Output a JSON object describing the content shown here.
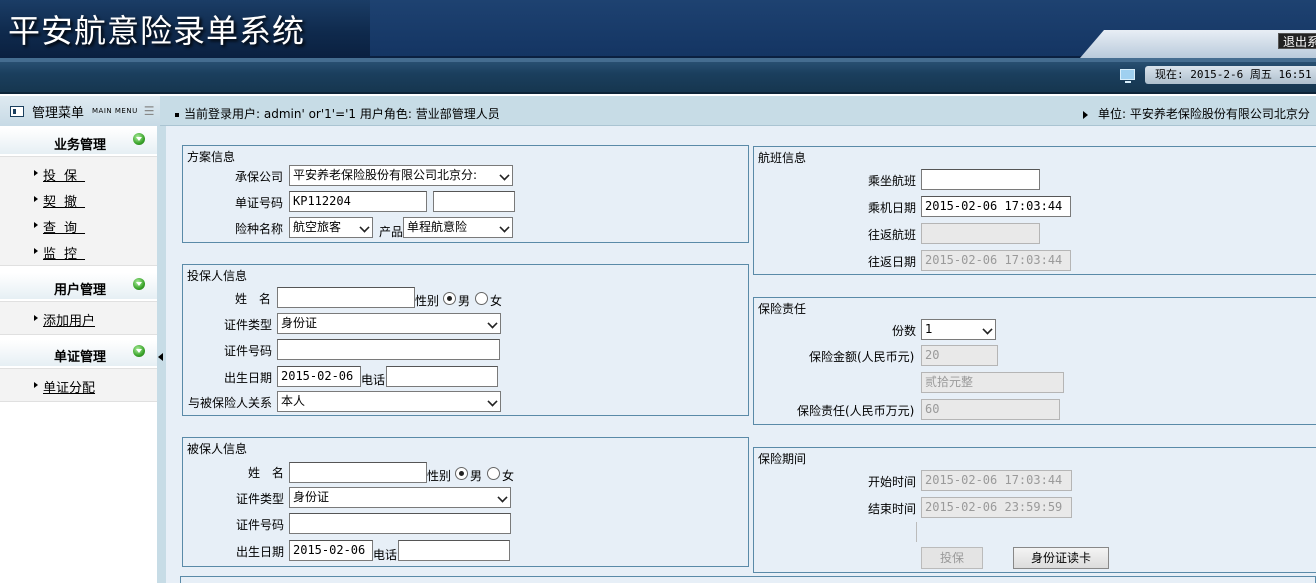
{
  "header": {
    "title": "平安航意险录单系统",
    "logout_label": "退出系",
    "time_text": "现在: 2015-2-6 周五 16:51"
  },
  "subheader": {
    "menu_label": "管理菜单",
    "menu_label_en": "MAIN MENU",
    "user_info": "当前登录用户: admin' or'1'='1   用户角色: 营业部管理人员",
    "unit_info": "单位: 平安养老保险股份有限公司北京分"
  },
  "sidebar": {
    "groups": [
      {
        "title": "业务管理",
        "items": [
          {
            "label": "投保"
          },
          {
            "label": "契撤"
          },
          {
            "label": "查询"
          },
          {
            "label": "监控"
          }
        ]
      },
      {
        "title": "用户管理",
        "items": [
          {
            "label": "添加用户"
          }
        ]
      },
      {
        "title": "单证管理",
        "items": [
          {
            "label": "单证分配"
          }
        ]
      }
    ]
  },
  "plan": {
    "legend": "方案信息",
    "company_label": "承保公司",
    "company_value": "平安养老保险股份有限公司北京分:",
    "cert_label": "单证号码",
    "cert_value": "KP112204",
    "cert_value2": "",
    "type_label": "险种名称",
    "type_value": "航空旅客",
    "product_label": "产品",
    "product_value": "单程航意险"
  },
  "applicant": {
    "legend": "投保人信息",
    "name_label": "姓  名",
    "name_value": "",
    "gender_label": "性别",
    "male": "男",
    "female": "女",
    "idtype_label": "证件类型",
    "idtype_value": "身份证",
    "idno_label": "证件号码",
    "idno_value": "",
    "birth_label": "出生日期",
    "birth_value": "2015-02-06",
    "phone_label": "电话",
    "phone_value": "",
    "relation_label": "与被保险人关系",
    "relation_value": "本人"
  },
  "insured": {
    "legend": "被保人信息",
    "name_label": "姓  名",
    "name_value": "",
    "gender_label": "性别",
    "male": "男",
    "female": "女",
    "idtype_label": "证件类型",
    "idtype_value": "身份证",
    "idno_label": "证件号码",
    "idno_value": "",
    "birth_label": "出生日期",
    "birth_value": "2015-02-06",
    "phone_label": "电话",
    "phone_value": ""
  },
  "flight": {
    "legend": "航班信息",
    "flight_label": "乘坐航班",
    "flight_value": "",
    "date_label": "乘机日期",
    "date_value": "2015-02-06 17:03:44",
    "return_flight_label": "往返航班",
    "return_flight_value": "",
    "return_date_label": "往返日期",
    "return_date_value": "2015-02-06 17:03:44"
  },
  "liability": {
    "legend": "保险责任",
    "copies_label": "份数",
    "copies_value": "1",
    "amount_label": "保险金额(人民币元)",
    "amount_value": "20",
    "amount_words": "贰拾元整",
    "liab_label": "保险责任(人民币万元)",
    "liab_value": "60"
  },
  "period": {
    "legend": "保险期间",
    "start_label": "开始时间",
    "start_value": "2015-02-06 17:03:44",
    "end_label": "结束时间",
    "end_value": "2015-02-06 23:59:59",
    "submit_label": "投保",
    "idcard_label": "身份证读卡"
  }
}
